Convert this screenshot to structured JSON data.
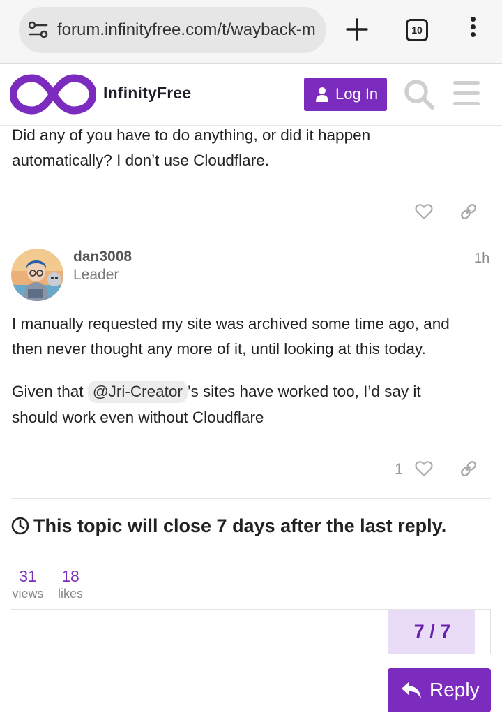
{
  "browser": {
    "url": "forum.infinityfree.com/t/wayback-m",
    "tab_count": "10"
  },
  "header": {
    "logo_text": "InfinityFree",
    "login_label": "Log In"
  },
  "post_top": {
    "line1": "Did any of you have to do anything, or did it happen",
    "line2": "automatically? I don’t use Cloudflare."
  },
  "post_main": {
    "username": "dan3008",
    "user_title": "Leader",
    "date": "1h",
    "p1_line1": "I manually requested my site was archived some time ago, and",
    "p1_line2": "then never thought any more of it, until looking at this today.",
    "p2_before": "Given that ",
    "mention": "@Jri-Creator",
    "p2_after": "’s sites have worked too, I’d say it",
    "p2_line2": "should work even without Cloudflare",
    "like_count": "1"
  },
  "topic": {
    "close_notice": "This topic will close 7 days after the last reply.",
    "views_count": "31",
    "views_label": "views",
    "likes_count": "18",
    "likes_label": "likes",
    "progress_text": "7 / 7",
    "progress_fraction": 0.85,
    "reply_label": "Reply"
  },
  "colors": {
    "brand": "#7b2cbf",
    "progress_bg": "#e8dcf7"
  },
  "icons": [
    "site-settings-icon",
    "plus-icon",
    "tab-switcher-icon",
    "more-vert-icon",
    "infinity-logo",
    "user-icon",
    "search-icon",
    "hamburger-menu-icon",
    "heart-icon",
    "link-icon",
    "clock-icon",
    "reply-arrow-icon"
  ]
}
